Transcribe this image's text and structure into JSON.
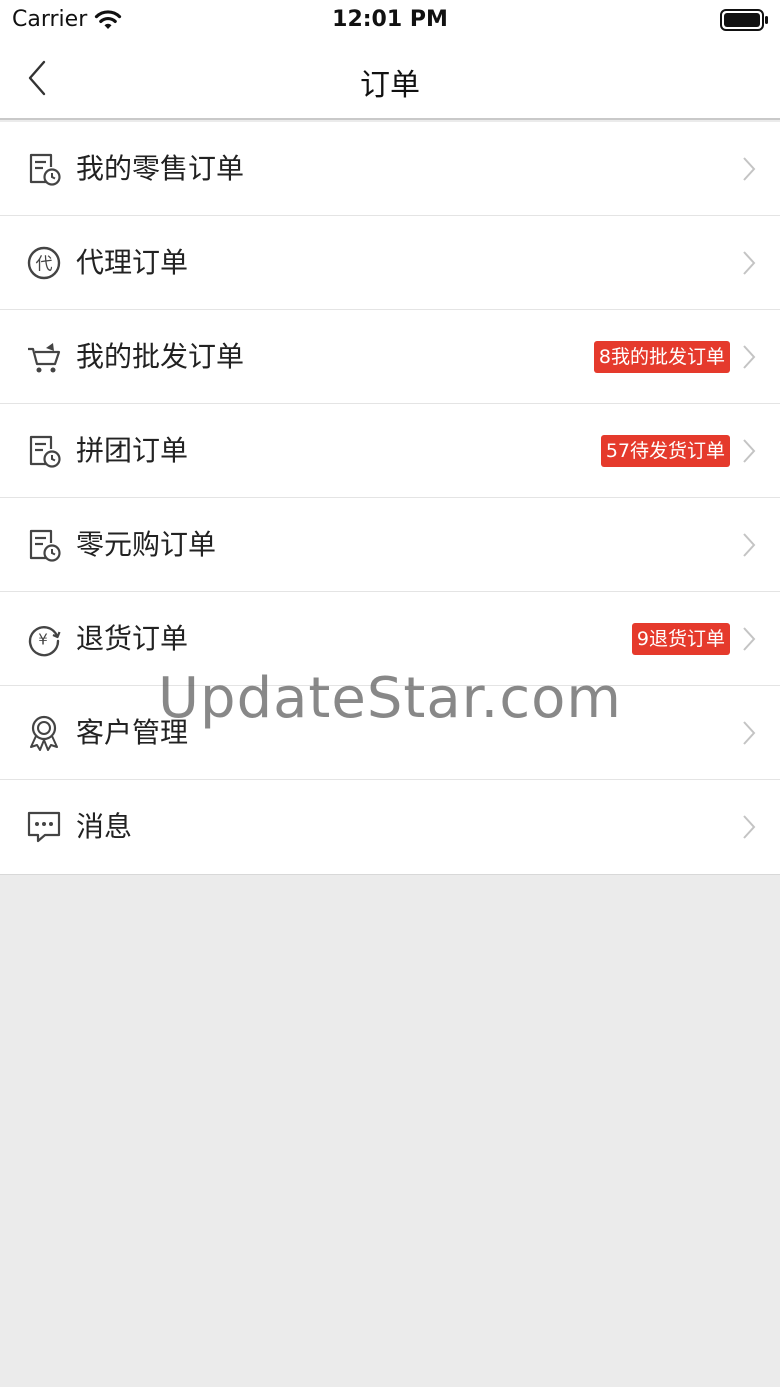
{
  "status_bar": {
    "carrier": "Carrier",
    "time": "12:01 PM"
  },
  "nav": {
    "title": "订单"
  },
  "menu": [
    {
      "label": "我的零售订单",
      "icon": "receipt-clock-icon",
      "badge": ""
    },
    {
      "label": "代理订单",
      "icon": "agent-circle-icon",
      "badge": ""
    },
    {
      "label": "我的批发订单",
      "icon": "cart-icon",
      "badge": "8我的批发订单"
    },
    {
      "label": "拼团订单",
      "icon": "receipt-clock-icon",
      "badge": "57待发货订单"
    },
    {
      "label": "零元购订单",
      "icon": "receipt-clock-icon",
      "badge": ""
    },
    {
      "label": "退货订单",
      "icon": "yuan-refund-icon",
      "badge": "9退货订单"
    },
    {
      "label": "客户管理",
      "icon": "award-medal-icon",
      "badge": ""
    },
    {
      "label": "消息",
      "icon": "chat-bubble-icon",
      "badge": ""
    }
  ],
  "watermark": "UpdateStar.com",
  "colors": {
    "badge": "#e53a2c",
    "background": "#ebebeb",
    "icon": "#444444"
  }
}
